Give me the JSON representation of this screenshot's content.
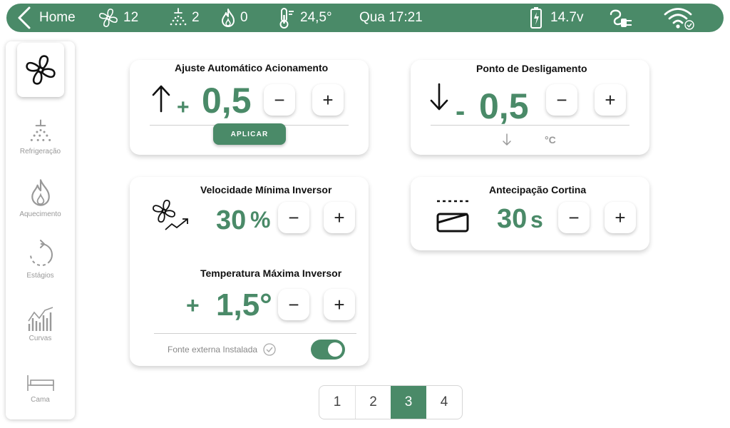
{
  "topbar": {
    "home_label": "Home",
    "fans": "12",
    "cooling": "2",
    "heating": "0",
    "temperature": "24,5°",
    "datetime": "Qua 17:21",
    "battery": "14.7v"
  },
  "sidebar": {
    "items": [
      {
        "label": ""
      },
      {
        "label": "Refrigeração"
      },
      {
        "label": "Aquecimento"
      },
      {
        "label": "Estágios"
      },
      {
        "label": "Curvas"
      },
      {
        "label": "Cama"
      }
    ]
  },
  "auto_adjust": {
    "title": "Ajuste Automático Acionamento",
    "sign": "+",
    "value": "0,5",
    "apply_label": "APLICAR"
  },
  "shutdown": {
    "title": "Ponto de Desligamento",
    "sign": "-",
    "value": "0,5",
    "unit": "°C"
  },
  "inverter": {
    "min_speed_title": "Velocidade Mínima Inversor",
    "min_speed_value": "30",
    "min_speed_unit": "%",
    "max_temp_title": "Temperatura Máxima Inversor",
    "max_temp_sign": "+",
    "max_temp_value": "1,5°",
    "external_source_label": "Fonte externa Instalada"
  },
  "curtain": {
    "title": "Antecipação Cortina",
    "value": "30",
    "unit": "s"
  },
  "controls": {
    "minus": "−",
    "plus": "+"
  },
  "pager": {
    "pages": [
      "1",
      "2",
      "3",
      "4"
    ],
    "active": "3"
  },
  "colors": {
    "accent": "#4a8a68"
  }
}
